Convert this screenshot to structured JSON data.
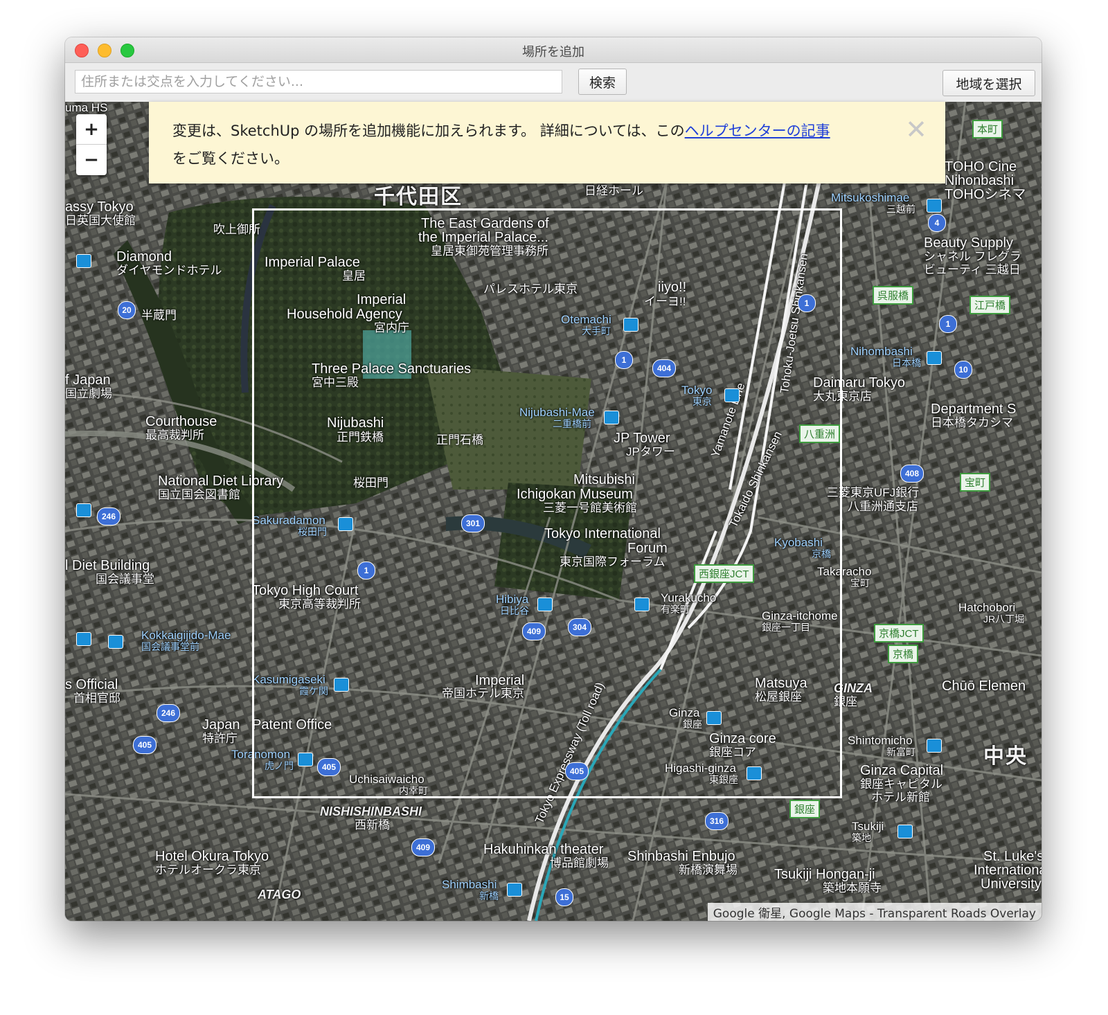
{
  "window": {
    "title": "場所を追加"
  },
  "toolbar": {
    "search_placeholder": "住所または交点を入力してください...",
    "search_button": "検索",
    "region_button": "地域を選択"
  },
  "zoom": {
    "in": "+",
    "out": "−"
  },
  "notice": {
    "text_before": "変更は、SketchUp の場所を追加機能に加えられます。 詳細については、この",
    "link": "ヘルプセンターの記事",
    "text_after": "をご覧ください。",
    "close": "✕"
  },
  "attribution": "Google 衛星, Google Maps - Transparent Roads Overlay",
  "map_labels": {
    "chiyoda": "千代田区",
    "east_gardens": "The East Gardens of",
    "east_gardens2": "the Imperial Palace...",
    "east_gardens_jp": "皇居東御苑管理事務所",
    "imperial_palace": "Imperial Palace",
    "imperial_palace_jp": "皇居",
    "imperial_household": "Imperial",
    "imperial_household2": "Household Agency",
    "imperial_household_jp": "宮内庁",
    "three_palace": "Three Palace Sanctuaries",
    "three_palace_jp": "宮中三殿",
    "nijubashi": "Nijubashi",
    "nijubashi_jp": "正門鉄橋",
    "seimon": "正門石橋",
    "sakuradamon_gate": "桜田門",
    "sakuradamon": "Sakuradamon",
    "sakuradamon_jp": "桜田門",
    "palace_hotel": "パレスホテル東京",
    "iiyo": "iiyo!!",
    "iiyo_jp": "イーヨ!!",
    "otemachi": "Otemachi",
    "otemachi_jp": "大手町",
    "tokyo": "Tokyo",
    "tokyo_jp": "東京",
    "nijubashi_mae": "Nijubashi-Mae",
    "nijubashi_mae_jp": "二重橋前",
    "jp_tower": "JP Tower",
    "jp_tower_jp": "JPタワー",
    "mitsubishi": "Mitsubishi",
    "mitsubishi2": "Ichigokan Museum",
    "mitsubishi_jp": "三菱一号館美術館",
    "intl_forum": "Tokyo International",
    "intl_forum2": "Forum",
    "intl_forum_jp": "東京国際フォーラム",
    "high_court": "Tokyo High Court",
    "high_court_jp": "東京高等裁判所",
    "hibiya": "Hibiya",
    "hibiya_jp": "日比谷",
    "yurakucho": "Yurakucho",
    "yurakucho_jp": "有楽町",
    "kasumigaseki": "Kasumigaseki",
    "kasumigaseki_jp": "霞ケ関",
    "imperial_hotel": "Imperial",
    "imperial_hotel_jp": "帝国ホテル東京",
    "patent": "Patent Office",
    "toranomon": "Toranomon",
    "toranomon_jp": "虎ノ門",
    "uchisaiwaicho": "Uchisaiwaicho",
    "uchisaiwaicho_jp": "内幸町",
    "ginza": "Ginza",
    "ginza_jp": "銀座",
    "ginza_core": "Ginza core",
    "ginza_core_jp": "銀座コア",
    "higashi_ginza": "Higashi-ginza",
    "higashi_ginza_jp": "東銀座",
    "matsuya": "Matsuya",
    "matsuya_jp": "松屋銀座",
    "ginza_itchome": "Ginza-itchome",
    "ginza_itchome_jp": "銀座一丁目",
    "kyobashi": "Kyobashi",
    "kyobashi_jp": "京橋",
    "takaracho": "Takaracho",
    "takaracho_jp": "宝町",
    "nishiginza_jct": "西銀座JCT",
    "kyobashi_jct": "京橋JCT",
    "yaesu": "八重洲",
    "nihonbashi": "Nihombashi",
    "nihonbashi_jp": "日本橋",
    "daimaru": "Daimaru Tokyo",
    "daimaru_jp": "大丸東京店",
    "department": "Department S",
    "department_jp": "日本橋タカシマ",
    "mufg": "三菱東京UFJ銀行",
    "mufg2": "八重洲通支店",
    "mitsukoshimae": "Mitsukoshimae",
    "mitsukoshimae_jp": "三越前",
    "beauty": "Beauty Supply",
    "beauty_jp": "シャネル フレグラ",
    "beauty_jp2": "ビューティ 三越日",
    "toho": "TOHO Cine",
    "toho2": "Nihonbashi",
    "toho_jp": "TOHOシネマ",
    "honcho": "本町",
    "gofukubashi": "呉服橋",
    "edobashi": "江戸橋",
    "takaracho2": "宝町",
    "hatchobori": "Hatchobori",
    "hatchobori_jp": "JR八丁堀",
    "kyobashi2": "京橋",
    "chuo": "Chūō Elemen",
    "chuo_jp": "中央",
    "ginza_area": "GINZA",
    "ginza_area_jp": "銀座",
    "shintomicho": "Shintomicho",
    "shintomicho_jp": "新富町",
    "ginza_capital": "Ginza Capital",
    "ginza_capital_jp": "銀座キャピタル",
    "ginza_capital_jp2": "ホテル新館",
    "ginza_jct2": "銀座",
    "tsukiji": "Tsukiji",
    "tsukiji_jp": "築地",
    "tsukiji_hongan": "Tsukiji Hongan-ji",
    "tsukiji_hongan_jp": "築地本願寺",
    "st_lukes": "St. Luke's",
    "st_lukes2": "International",
    "st_lukes3": "University",
    "shinbashi_enbujo": "Shinbashi Enbujo",
    "shinbashi_enbujo_jp": "新橋演舞場",
    "hakuhinkan": "Hakuhinkan theater",
    "hakuhinkan_jp": "博品館劇場",
    "shimbashi": "Shimbashi",
    "shimbashi_jp": "新橋",
    "nishishinbashi": "NISHISHINBASHI",
    "nishishinbashi_jp": "西新橋",
    "hotel_okura": "Hotel Okura Tokyo",
    "hotel_okura_jp": "ホテルオークラ東京",
    "atago": "ATAGO",
    "japan_patent": "Japan",
    "japan_patent_jp": "特許庁",
    "pm_official": "s Official",
    "pm_official_jp": "首相官邸",
    "kokkaigijido": "Kokkaigijido-Mae",
    "kokkaigijido_jp": "国会議事堂前",
    "diet_building": "l Diet Building",
    "diet_building_jp": "国会議事堂",
    "ndl": "National Diet Library",
    "ndl_jp": "国立国会図書館",
    "courthouse": "Courthouse",
    "courthouse_jp": "最高裁判所",
    "national_theatre": "f Japan",
    "national_theatre_jp": "国立劇場",
    "hanzomon": "半蔵門",
    "diamond": "Diamond",
    "diamond_jp": "ダイヤモンドホテル",
    "embassy": "assy Tokyo",
    "embassy_jp": "日英国大使館",
    "fukiage": "吹上御所",
    "nikkei": "日経ホール",
    "yamanote": "Yamanote Line",
    "tokaido": "Tokaido Shinkansen",
    "tohoku": "Tohoku-Joetsu Shinkansen",
    "expressway": "Tokyo Expressway (Toll road)",
    "uma": "uma HS"
  },
  "route_badges": [
    "1",
    "404",
    "301",
    "1",
    "409",
    "304",
    "405",
    "405",
    "409",
    "246",
    "20",
    "246",
    "405",
    "316",
    "408",
    "10",
    "1",
    "1",
    "4",
    "15"
  ]
}
